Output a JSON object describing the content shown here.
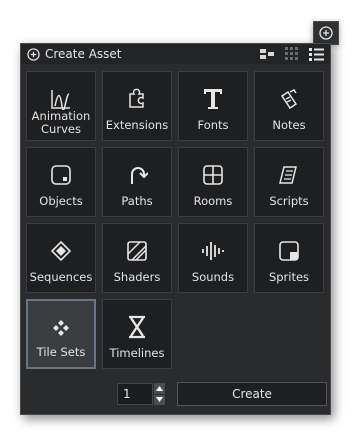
{
  "corner_button": {
    "icon": "plus-circle-icon"
  },
  "header": {
    "title": "Create Asset",
    "icon": "plus-circle-icon",
    "tools": [
      "folder-tree-icon",
      "grid-view-icon",
      "list-view-icon"
    ]
  },
  "assets": [
    {
      "label": "Animation Curves",
      "icon": "animation-curve-icon"
    },
    {
      "label": "Extensions",
      "icon": "puzzle-icon"
    },
    {
      "label": "Fonts",
      "icon": "font-icon"
    },
    {
      "label": "Notes",
      "icon": "note-icon"
    },
    {
      "label": "Objects",
      "icon": "object-icon"
    },
    {
      "label": "Paths",
      "icon": "path-icon"
    },
    {
      "label": "Rooms",
      "icon": "room-icon"
    },
    {
      "label": "Scripts",
      "icon": "script-icon"
    },
    {
      "label": "Sequences",
      "icon": "sequence-icon"
    },
    {
      "label": "Shaders",
      "icon": "shader-icon"
    },
    {
      "label": "Sounds",
      "icon": "sound-icon"
    },
    {
      "label": "Sprites",
      "icon": "sprite-icon"
    },
    {
      "label": "Tile Sets",
      "icon": "tileset-icon",
      "selected": true
    },
    {
      "label": "Timelines",
      "icon": "timeline-icon"
    }
  ],
  "footer": {
    "quantity": "1",
    "create_label": "Create"
  }
}
